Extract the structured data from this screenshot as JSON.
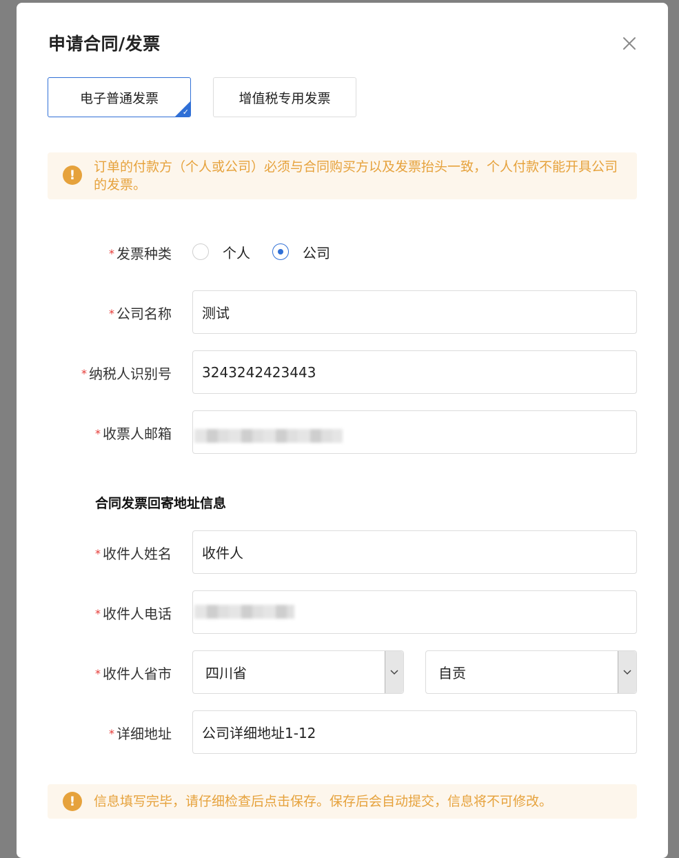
{
  "dialog": {
    "title": "申请合同/发票",
    "tabs": [
      {
        "label": "电子普通发票",
        "active": true
      },
      {
        "label": "增值税专用发票",
        "active": false
      }
    ],
    "top_alert": "订单的付款方（个人或公司）必须与合同购买方以及发票抬头一致，个人付款不能开具公司的发票。",
    "alert_icon": "exclamation-icon",
    "form": {
      "required_mark": "*",
      "invoice_type": {
        "label": "发票种类",
        "options": [
          {
            "label": "个人",
            "checked": false
          },
          {
            "label": "公司",
            "checked": true
          }
        ]
      },
      "company_name": {
        "label": "公司名称",
        "value": "测试"
      },
      "taxpayer_id": {
        "label": "纳税人识别号",
        "value": "3243242423443"
      },
      "email": {
        "label": "收票人邮箱",
        "value": ""
      },
      "section_title": "合同发票回寄地址信息",
      "recipient_name": {
        "label": "收件人姓名",
        "value": "收件人"
      },
      "recipient_phone": {
        "label": "收件人电话",
        "value": ""
      },
      "recipient_region": {
        "label": "收件人省市",
        "province": "四川省",
        "city": "自贡"
      },
      "address": {
        "label": "详细地址",
        "value": "公司详细地址1-12"
      }
    },
    "bottom_alert": "信息填写完毕，请仔细检查后点击保存。保存后会自动提交，信息将不可修改。"
  },
  "colors": {
    "accent": "#2f6fd6",
    "warning": "#e6a23c",
    "warning_bg": "#fdf6ec",
    "required": "#e53935"
  }
}
